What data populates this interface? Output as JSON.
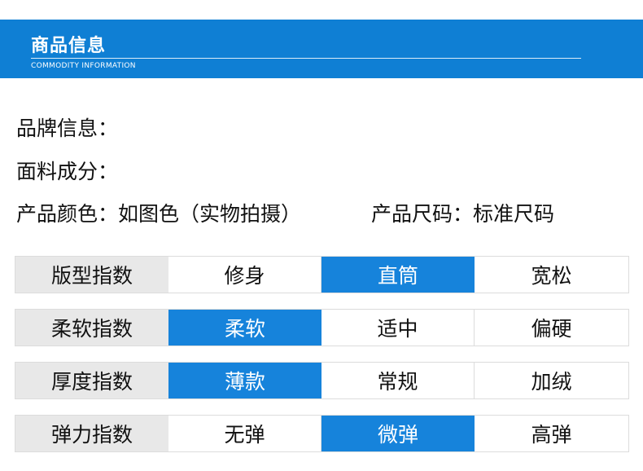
{
  "colors": {
    "banner": "#0f7fd4",
    "active": "#1683db",
    "label_bg": "#e8e8e8"
  },
  "header": {
    "title": "商品信息",
    "subtitle": "COMMODITY INFORMATION"
  },
  "info": {
    "brand": "品牌信息：",
    "fabric": "面料成分：",
    "color_label": "产品颜色：",
    "color_value": "如图色（实物拍摄）",
    "size_label": "产品尺码：",
    "size_value": "标准尺码"
  },
  "rows": [
    {
      "label": "版型指数",
      "options": [
        "修身",
        "直筒",
        "宽松"
      ],
      "selected": 1
    },
    {
      "label": "柔软指数",
      "options": [
        "柔软",
        "适中",
        "偏硬"
      ],
      "selected": 0
    },
    {
      "label": "厚度指数",
      "options": [
        "薄款",
        "常规",
        "加绒"
      ],
      "selected": 0
    },
    {
      "label": "弹力指数",
      "options": [
        "无弹",
        "微弹",
        "高弹"
      ],
      "selected": 1
    }
  ]
}
